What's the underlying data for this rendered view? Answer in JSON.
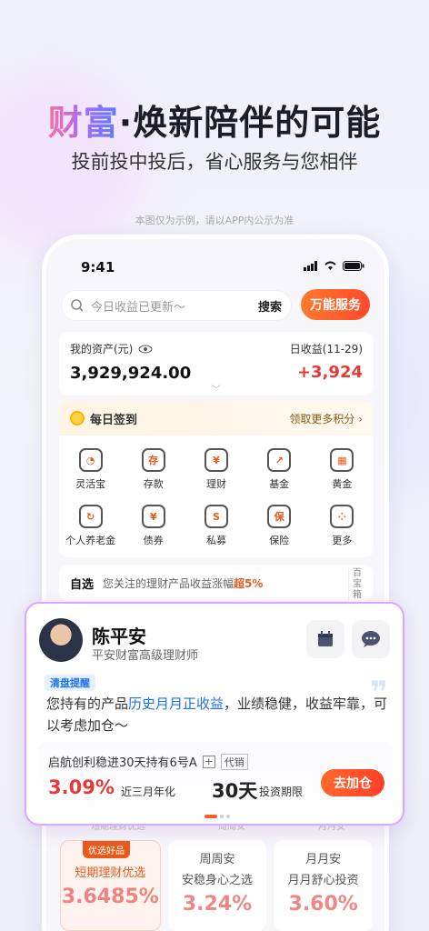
{
  "hero": {
    "title_highlight": "财富",
    "title_dot": "·",
    "title_rest": "焕新陪伴的可能",
    "subtitle": "投前投中投后，省心服务与您相伴",
    "disclaimer": "本图仅为示例，请以APP内公示为准"
  },
  "status": {
    "time": "9:41"
  },
  "search": {
    "placeholder": "今日收益已更新～",
    "button": "搜索",
    "service": "万能服务"
  },
  "assets": {
    "label": "我的资产(元)",
    "value": "3,929,924.00",
    "daily_label": "日收益(11-29)",
    "daily_value": "+3,924"
  },
  "signin": {
    "title": "每日签到",
    "more": "领取更多积分 ›"
  },
  "menu": [
    {
      "label": "灵活宝",
      "icon": "wallet-icon",
      "glyph": "◔"
    },
    {
      "label": "存款",
      "icon": "deposit-icon",
      "glyph": "存"
    },
    {
      "label": "理财",
      "icon": "wealth-icon",
      "glyph": "¥"
    },
    {
      "label": "基金",
      "icon": "fund-icon",
      "glyph": "↗"
    },
    {
      "label": "黄金",
      "icon": "gold-icon",
      "glyph": "▦"
    },
    {
      "label": "个人养老金",
      "icon": "pension-icon",
      "glyph": "↻"
    },
    {
      "label": "债券",
      "icon": "bond-icon",
      "glyph": "¥"
    },
    {
      "label": "私募",
      "icon": "private-fund-icon",
      "glyph": "S"
    },
    {
      "label": "保险",
      "icon": "insurance-icon",
      "glyph": "保"
    },
    {
      "label": "更多",
      "icon": "more-icon",
      "glyph": "⁘"
    }
  ],
  "watchlist": {
    "title": "自选",
    "text": "您关注的理财产品收益涨幅",
    "highlight": "超5%",
    "side": "百宝箱"
  },
  "advisor": {
    "name": "陈平安",
    "title": "平安财富高级理财师",
    "tag": "清盘提醒",
    "msg_a": "您持有的产品",
    "msg_hl": "历史月月正收益",
    "msg_b": "，业绩稳健，收益牢靠，可以考虑加仓～",
    "quote": "❞"
  },
  "product": {
    "name": "启航创利稳进30天持有6号A",
    "plus": "+",
    "agent": "代销",
    "rate": "3.09%",
    "rate_label": "近三月年化",
    "term": "30天",
    "term_label": "投资期限",
    "buy": "去加仓"
  },
  "bottom_faded": [
    "短期理财优选",
    "周周安",
    "月月安"
  ],
  "bottom": [
    {
      "badge": "优选好品",
      "a": "短期理财优选",
      "b": "",
      "c": "3.6485%"
    },
    {
      "badge": "",
      "a": "周周安",
      "b": "安稳身心之选",
      "c": "3.24%"
    },
    {
      "badge": "",
      "a": "月月安",
      "b": "月月舒心投资",
      "c": "3.60%"
    }
  ]
}
